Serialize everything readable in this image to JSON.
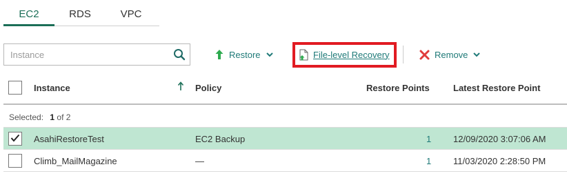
{
  "tabs": [
    {
      "label": "EC2",
      "active": true
    },
    {
      "label": "RDS",
      "active": false
    },
    {
      "label": "VPC",
      "active": false
    }
  ],
  "search": {
    "placeholder": "Instance",
    "icon": "search-icon"
  },
  "toolbar": {
    "restore_label": "Restore",
    "file_level_recovery_label": "File-level Recovery",
    "remove_label": "Remove",
    "highlight_color": "#e11b22",
    "accent_color": "#1f7a78",
    "restore_icon_color": "#2eaa4f",
    "remove_icon_color": "#e03c3c"
  },
  "table": {
    "columns": {
      "instance": "Instance",
      "policy": "Policy",
      "restore_points": "Restore Points",
      "latest_restore_point": "Latest Restore Point"
    },
    "sort": {
      "column": "instance",
      "direction": "ascending"
    },
    "selection": {
      "prefix": "Selected:",
      "count": "1",
      "suffix": "of 2"
    },
    "rows": [
      {
        "instance": "AsahiRestoreTest",
        "policy": "EC2 Backup",
        "restore_points": "1",
        "latest": "12/09/2020 3:07:06 AM",
        "selected": true
      },
      {
        "instance": "Climb_MailMagazine",
        "policy": "—",
        "restore_points": "1",
        "latest": "11/03/2020 2:28:50 PM",
        "selected": false
      }
    ]
  },
  "colors": {
    "tab_active": "#1b6e57",
    "selected_row": "#bfe6d2"
  }
}
